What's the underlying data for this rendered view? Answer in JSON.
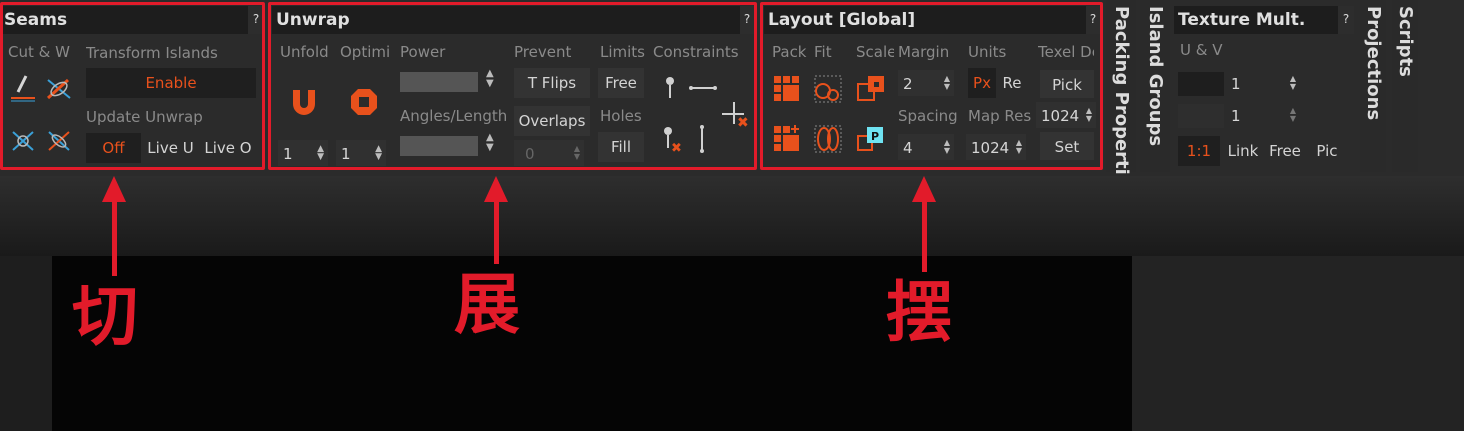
{
  "panels": {
    "seams": {
      "title": "Seams",
      "help": "?",
      "cut_label": "Cut & W",
      "transform_label": "Transform Islands",
      "enable_label": "Enable",
      "update_label": "Update Unwrap",
      "off_label": "Off",
      "live_u_label": "Live U",
      "live_o_label": "Live O"
    },
    "unwrap": {
      "title": "Unwrap",
      "help": "?",
      "unfold_label": "Unfold",
      "optimize_label": "Optimi",
      "power_label": "Power",
      "angles_label": "Angles/Length",
      "prevent_label": "Prevent",
      "t_flips_label": "T Flips",
      "overlaps_label": "Overlaps",
      "overlaps_value": "0",
      "limits_label": "Limits",
      "free_label": "Free",
      "holes_label": "Holes",
      "fill_label": "Fill",
      "constraints_label": "Constraints",
      "unfold_value": "1",
      "optimize_value": "1"
    },
    "layout": {
      "title": "Layout [Global]",
      "help": "?",
      "pack_label": "Pack",
      "fit_label": "Fit",
      "scale_label": "Scale",
      "margin_label": "Margin",
      "margin_value": "2",
      "spacing_label": "Spacing",
      "spacing_value": "4",
      "units_label": "Units",
      "px_label": "Px",
      "re_label": "Re",
      "map_res_label": "Map Res",
      "map_res_value": "1024",
      "texel_label": "Texel De",
      "pick_label": "Pick",
      "texel_value": "1024",
      "set_label": "Set"
    },
    "vertical_tabs": {
      "packing": "Packing Properti",
      "island": "Island Groups"
    },
    "texture": {
      "title": "Texture Mult.",
      "help": "?",
      "uv_label": "U & V",
      "u_value": "1",
      "v_value": "1",
      "ratio_label": "1:1",
      "link_label": "Link",
      "free_label": "Free",
      "pic_label": "Pic"
    },
    "right_tabs": {
      "projections": "Projections",
      "scripts": "Scripts"
    }
  },
  "annotations": {
    "cut": "切",
    "unwrap": "展",
    "layout": "摆"
  },
  "colors": {
    "accent_orange": "#e8511c",
    "annotation_red": "#e21b2a",
    "panel_bg": "#2b2b2b",
    "header_bg": "#1d1d1d"
  },
  "icons": {
    "seam_cut": "pen-cut-icon",
    "seam_weld": "cross-weld-icon",
    "unfold": "u-magnet-icon",
    "optimize": "stop-octagon-icon",
    "pack": "pack-grid-icon",
    "fit": "fit-circles-icon",
    "scale": "scale-squares-icon"
  }
}
